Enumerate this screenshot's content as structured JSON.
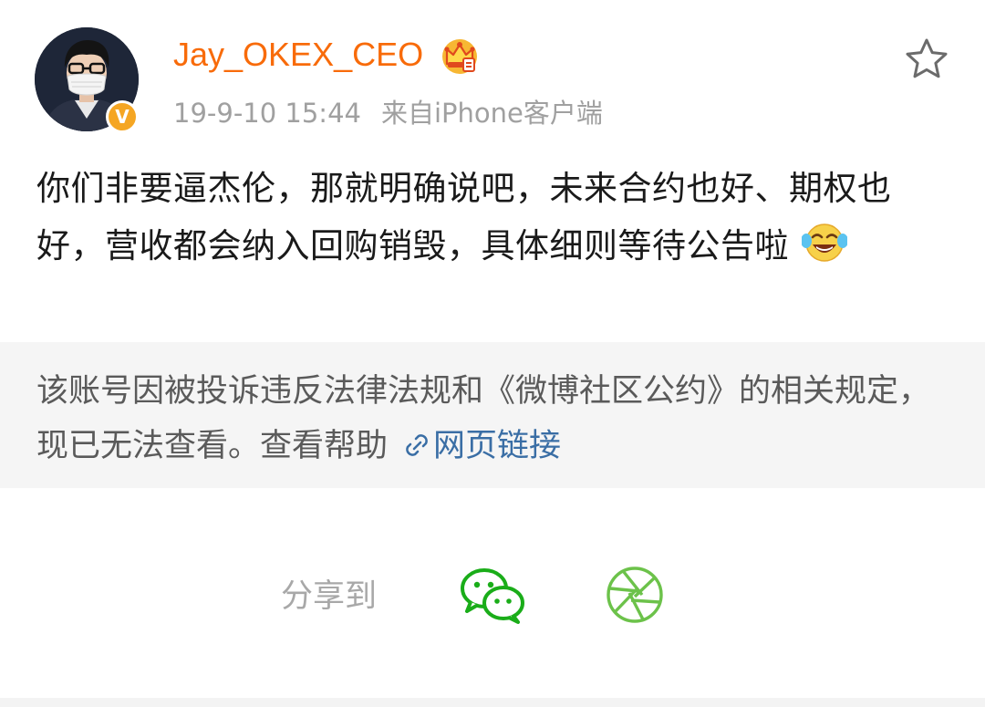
{
  "post": {
    "author": {
      "username": "Jay_OKEX_CEO",
      "verified_badge": "V",
      "avatar_icon": "avatar-person-with-mask",
      "vip_icon": "crown-icon"
    },
    "meta": {
      "timestamp": "19-9-10 15:44",
      "source": "来自iPhone客户端"
    },
    "text": "你们非要逼杰伦，那就明确说吧，未来合约也好、期权也好，营收都会纳入回购销毁，具体细则等待公告啦",
    "emoji": "laughing-crying-emoji"
  },
  "notice": {
    "text": "该账号因被投诉违反法律法规和《微博社区公约》的相关规定，现已无法查看。",
    "help_label": "查看帮助",
    "link_label": "网页链接"
  },
  "share": {
    "label": "分享到",
    "targets": [
      "wechat-icon",
      "moments-icon"
    ]
  },
  "colors": {
    "username": "#f86b0a",
    "meta": "#a0a0a0",
    "link": "#3a6ea5",
    "notice_bg": "#f5f5f5",
    "wechat": "#1aad19",
    "moments": "#6cc24a",
    "badge": "#f5a623"
  }
}
